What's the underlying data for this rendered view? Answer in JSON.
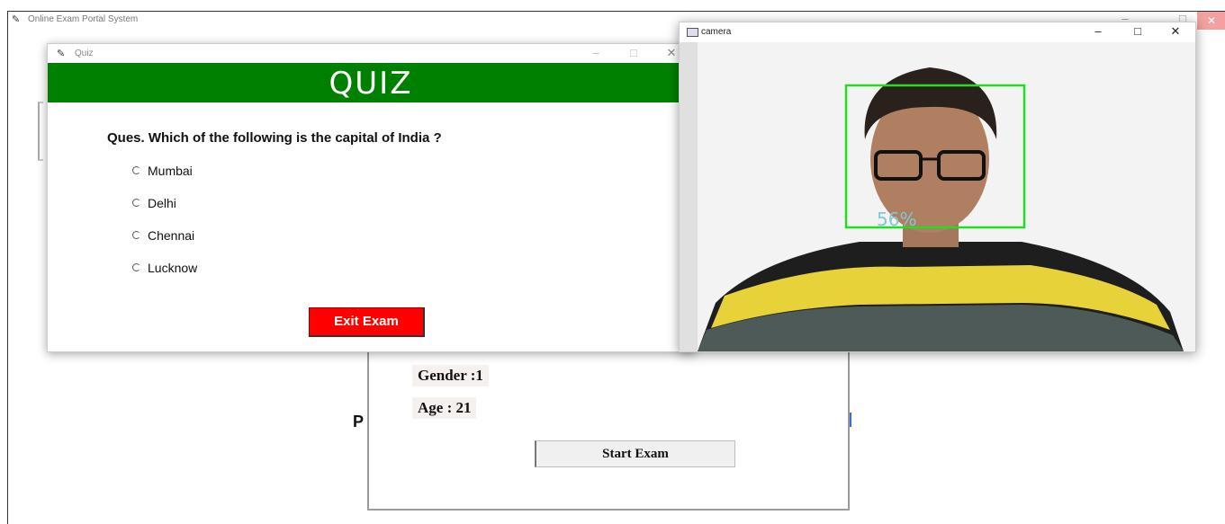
{
  "main_window": {
    "title": "Online Exam Portal System"
  },
  "profile": {
    "gender_label": "Gender :1",
    "age_label": "Age :  21",
    "start_button": "Start Exam",
    "partial_letter": "P"
  },
  "quiz_window": {
    "title": "Quiz",
    "heading": "QUIZ",
    "question": "Ques. Which of the following is the capital of India ?",
    "options": [
      "Mumbai",
      "Delhi",
      "Chennai",
      "Lucknow"
    ],
    "exit_button": "Exit Exam",
    "header_color": "#008000",
    "exit_color": "#ff0000"
  },
  "camera_window": {
    "title": "camera",
    "confidence": "56%",
    "box_color": "#22dd22"
  }
}
